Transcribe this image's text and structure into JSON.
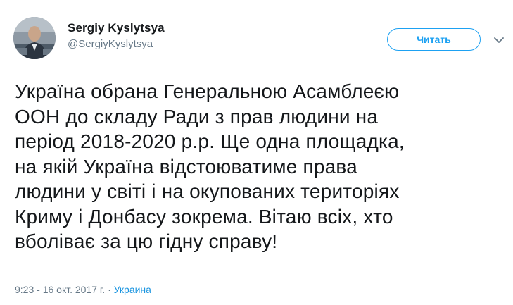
{
  "author": {
    "display_name": "Sergiy Kyslytsya",
    "handle": "@SergiyKyslytsya"
  },
  "follow_button": {
    "label": "Читать"
  },
  "icons": {
    "more": "chevron-down-icon",
    "avatar": "profile-photo"
  },
  "tweet": {
    "lines": [
      "Україна обрана Генеральною Асамблеєю",
      "ООН до складу Ради з прав людини на",
      "період 2018-2020 р.р. Ще одна площадка,",
      "на якій Україна відстоюватиме права",
      "людини у світі і на окупованих територіях",
      "Криму і Донбасу зокрема. Вітаю всіх, хто",
      "вболіває за цю гідну справу!"
    ],
    "timestamp": "9:23 - 16 окт. 2017 г.",
    "location": "Украина"
  },
  "colors": {
    "accent": "#1da1f2",
    "text": "#14171a",
    "secondary": "#657786",
    "link": "#1b95e0"
  }
}
